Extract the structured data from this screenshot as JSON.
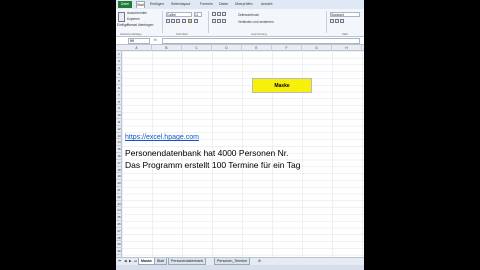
{
  "ribbon_tabs": {
    "file": "Datei",
    "items": [
      "Start",
      "Einfügen",
      "Seitenlayout",
      "Formeln",
      "Daten",
      "Überprüfen",
      "Ansicht"
    ]
  },
  "clipboard": {
    "cut": "Ausschneiden",
    "copy": "Kopieren",
    "format_painter": "Format übertragen",
    "paste": "Einfügen",
    "group": "Zwischenablage"
  },
  "font": {
    "name": "Calibri",
    "size": "11",
    "group": "Schriftart"
  },
  "alignment": {
    "wrap": "Zeilenumbruch",
    "merge": "Verbinden und zentrieren",
    "group": "Ausrichtung"
  },
  "number": {
    "format": "Standard",
    "group": "Zahl"
  },
  "formula_bar": {
    "name_box": "N9",
    "fx": "fx",
    "value": ""
  },
  "columns": [
    "A",
    "B",
    "C",
    "D",
    "E",
    "F",
    "G",
    "H"
  ],
  "rows": [
    "1",
    "2",
    "3",
    "4",
    "5",
    "6",
    "7",
    "8",
    "9",
    "10",
    "11",
    "12",
    "13",
    "14",
    "15",
    "16",
    "17",
    "18",
    "19",
    "20",
    "21",
    "22",
    "23",
    "24",
    "25",
    "26",
    "27",
    "28",
    "29",
    "30"
  ],
  "sheet": {
    "button_label": "Maske",
    "link": "https://excel.hpage.com",
    "line1": "Personendatenbank hat 4000 Personen Nr.",
    "line2": "Das Programm erstellt 100 Termine für ein Tag"
  },
  "sheet_tabs": [
    "Maske",
    "Blatt",
    "Personendatenbank",
    "Personen_Termine"
  ],
  "colors": {
    "file_tab": "#1e7b34",
    "button_fill": "#f7f00a",
    "link": "#1155cc"
  }
}
